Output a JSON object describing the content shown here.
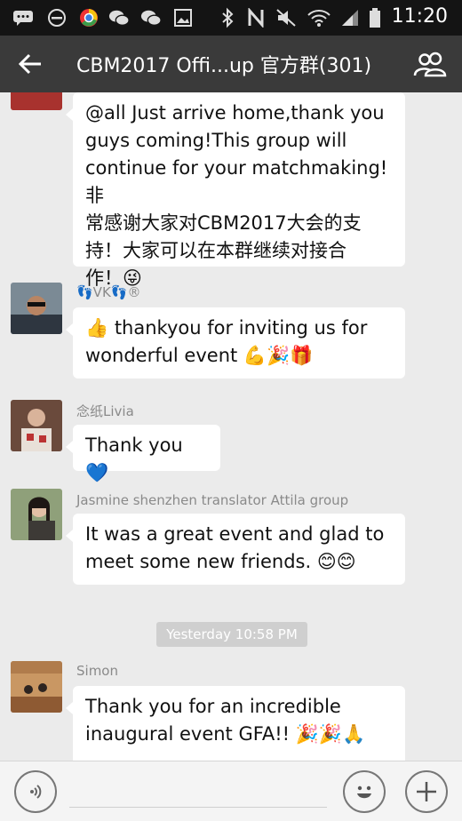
{
  "status_bar": {
    "time": "11:20",
    "icons": [
      "message-icon",
      "do-not-disturb-icon",
      "chrome-icon",
      "wechat-icon",
      "wechat-icon",
      "gallery-icon",
      "bluetooth-icon",
      "nfc-icon",
      "mute-icon",
      "wifi-icon",
      "signal-icon",
      "battery-icon"
    ]
  },
  "header": {
    "title": "CBM2017 Offi...up 官方群(301)",
    "back_icon": "back-arrow-icon",
    "members_icon": "group-members-icon"
  },
  "messages": [
    {
      "sender": "",
      "lines": [
        "@all Just arrive home,thank you",
        "guys coming!This group will",
        "continue for your matchmaking!非",
        "常感谢大家对CBM2017大会的支",
        "持！大家可以在本群继续对接合",
        "作！😜"
      ]
    },
    {
      "sender": "👣VK👣®",
      "lines": [
        "👍 thankyou for inviting us for",
        "wonderful event 💪🎉🎁"
      ]
    },
    {
      "sender": "念纸Livia",
      "lines": [
        "Thank you 💙"
      ]
    },
    {
      "sender": "Jasmine shenzhen translator Attila group",
      "lines": [
        "It was a great event and glad to",
        "meet some new friends. 😊😊"
      ]
    },
    {
      "sender": "Simon",
      "lines": [
        "Thank you for an incredible",
        "inaugural event GFA!! 🎉🎉🙏"
      ]
    }
  ],
  "timestamp": "Yesterday 10:58 PM",
  "input_bar": {
    "voice_icon": "voice-icon",
    "emoji_icon": "emoji-icon",
    "plus_icon": "plus-icon",
    "message_value": ""
  },
  "colors": {
    "status_bar": "#141414",
    "title_bar": "#3a3a3a",
    "chat_background": "#ebebeb",
    "bubble": "#ffffff"
  }
}
